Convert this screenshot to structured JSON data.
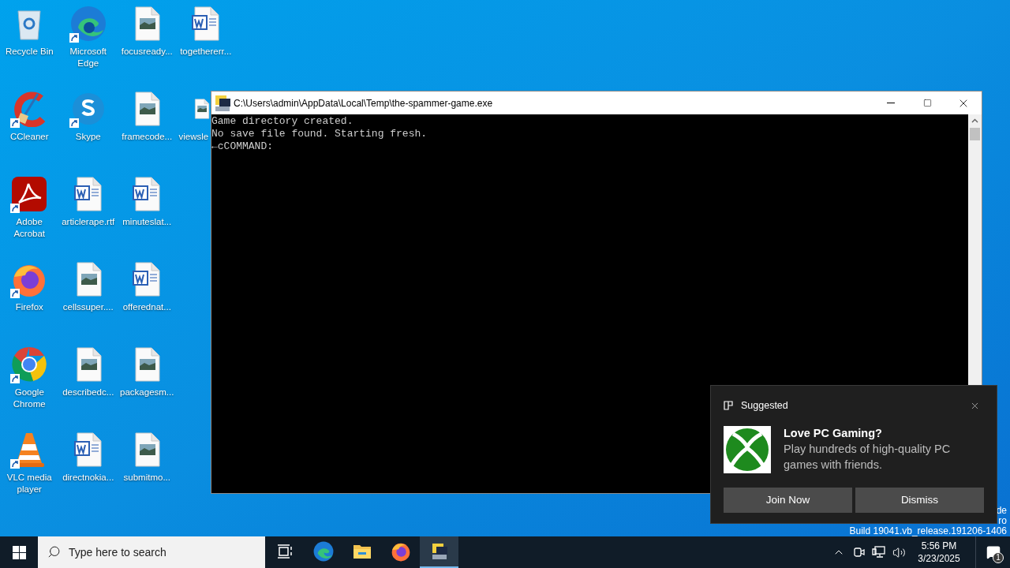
{
  "desktop": {
    "columns": [
      [
        {
          "kind": "recycle-bin",
          "label": "Recycle Bin",
          "shortcut": false
        },
        {
          "kind": "ccleaner",
          "label": "CCleaner",
          "shortcut": true
        },
        {
          "kind": "acrobat",
          "label": "Adobe Acrobat",
          "shortcut": true
        },
        {
          "kind": "firefox",
          "label": "Firefox",
          "shortcut": true
        },
        {
          "kind": "chrome",
          "label": "Google Chrome",
          "shortcut": true
        },
        {
          "kind": "vlc",
          "label": "VLC media player",
          "shortcut": true
        }
      ],
      [
        {
          "kind": "edge",
          "label": "Microsoft Edge",
          "shortcut": true
        },
        {
          "kind": "skype",
          "label": "Skype",
          "shortcut": true
        },
        {
          "kind": "word",
          "label": "articlerape.rtf",
          "shortcut": false
        },
        {
          "kind": "image",
          "label": "cellssuper....",
          "shortcut": false
        },
        {
          "kind": "image",
          "label": "describedc...",
          "shortcut": false
        },
        {
          "kind": "word",
          "label": "directnokia...",
          "shortcut": false
        }
      ],
      [
        {
          "kind": "image",
          "label": "focusready...",
          "shortcut": false
        },
        {
          "kind": "image",
          "label": "framecode...",
          "shortcut": false
        },
        {
          "kind": "word",
          "label": "minuteslat...",
          "shortcut": false
        },
        {
          "kind": "word",
          "label": "offerednat...",
          "shortcut": false
        },
        {
          "kind": "image",
          "label": "packagesm...",
          "shortcut": false
        },
        {
          "kind": "image",
          "label": "submitmo...",
          "shortcut": false
        }
      ],
      [
        {
          "kind": "word",
          "label": "togethererr...",
          "shortcut": false
        },
        {
          "kind": "image",
          "label": "viewsle",
          "shortcut": false
        }
      ]
    ],
    "watermark": [
      "de",
      "ro",
      "Build 19041.vb_release.191206-1406"
    ]
  },
  "console": {
    "title": "C:\\Users\\admin\\AppData\\Local\\Temp\\the-spammer-game.exe",
    "lines": [
      "Game directory created.",
      "No save file found. Starting fresh.",
      "←cCOMMAND:"
    ]
  },
  "notification": {
    "header": "Suggested",
    "title": "Love PC Gaming?",
    "body": "Play hundreds of high-quality PC games with friends.",
    "buttons": [
      "Join Now",
      "Dismiss"
    ]
  },
  "taskbar": {
    "search": {
      "placeholder": "Type here to search"
    },
    "apps": [
      {
        "kind": "task-view",
        "selected": false
      },
      {
        "kind": "edge",
        "selected": false
      },
      {
        "kind": "explorer",
        "selected": false
      },
      {
        "kind": "firefox",
        "selected": false
      },
      {
        "kind": "console",
        "selected": true
      }
    ],
    "time": "5:56 PM",
    "date": "3/23/2025",
    "notification_count": "1"
  }
}
